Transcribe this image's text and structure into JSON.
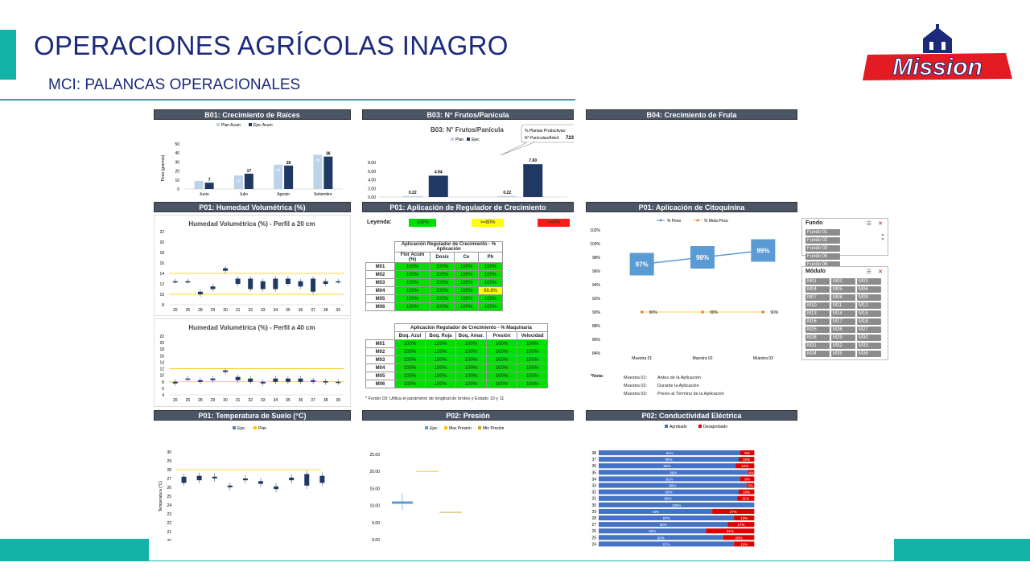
{
  "header": {
    "title": "OPERACIONES AGRÍCOLAS INAGRO",
    "subtitle": "MCI: PALANCAS OPERACIONALES",
    "logo_text": "Mission"
  },
  "panels": {
    "b01": "B01: Crecimiento de Raíces",
    "b03": "B03: N° Frutos/Panícula",
    "b04": "B04: Crecimiento de Fruta",
    "p01_humedad": "P01: Humedad Volumétrica (%)",
    "p01_regulador": "P01: Aplicación de Regulador de Crecimiento",
    "p01_citoquinina": "P01: Aplicación de Citoquinina",
    "p01_temp": "P01: Temperatura de Suelo (°C)",
    "p02_presion": "P02: Presión",
    "p02_conductividad": "P02: Conductividad Eléctrica"
  },
  "b03_callout": {
    "label1": "% Plantas Productivas:",
    "value1": "94",
    "label2": "N° Panículas/Árbol:",
    "value2": "723"
  },
  "regulador": {
    "leyenda_label": "Leyenda:",
    "leyenda": [
      "100%",
      ">=80%",
      ">=0%"
    ],
    "table1_title": "Aplicación Regulador de Crecimiento - % Aplicación",
    "table1_headers": [
      "Flor Acum (%)",
      "Dosis",
      "Ce",
      "Ph"
    ],
    "table2_title": "Aplicación Regulador de Crecimiento - % Maquinaria",
    "table2_headers": [
      "Boq. Azul",
      "Boq. Roja",
      "Boq. Amar.",
      "Presión",
      "Velocidad"
    ],
    "rows": [
      "M01",
      "M02",
      "M03",
      "M04",
      "M05",
      "M06"
    ],
    "t1_cells": [
      [
        "100%",
        "100%",
        "100%",
        "100%"
      ],
      [
        "100%",
        "100%",
        "100%",
        "100%"
      ],
      [
        "100%",
        "100%",
        "100%",
        "100%"
      ],
      [
        "100%",
        "100%",
        "100%",
        "99.8%"
      ],
      [
        "100%",
        "100%",
        "100%",
        "100%"
      ],
      [
        "100%",
        "100%",
        "100%",
        "100%"
      ]
    ],
    "t2_cells": [
      [
        "100%",
        "100%",
        "100%",
        "100%",
        "100%"
      ],
      [
        "100%",
        "100%",
        "100%",
        "100%",
        "100%"
      ],
      [
        "100%",
        "100%",
        "100%",
        "100%",
        "100%"
      ],
      [
        "100%",
        "100%",
        "100%",
        "100%",
        "100%"
      ],
      [
        "100%",
        "100%",
        "100%",
        "100%",
        "100%"
      ],
      [
        "100%",
        "100%",
        "100%",
        "100%",
        "100%"
      ]
    ],
    "footnote": "* Fundo 03: Utiliza el parámetro de longitud de brotes y Estado 10 y 11"
  },
  "citoquinina_notes": {
    "label": "*Nota:",
    "rows": [
      [
        "Muestra 01:",
        "Antes de la Aplicación"
      ],
      [
        "Muestra 02:",
        "Durante la Aplicación"
      ],
      [
        "Muestra 03:",
        "Previo al Término de la Aplicación"
      ]
    ]
  },
  "slicer_fundo": {
    "title": "Fundo",
    "items": [
      "Fundo 01",
      "Fundo 02",
      "Fundo 03",
      "Fundo 05",
      "Fundo 06",
      "ENSAYO"
    ]
  },
  "slicer_modulo": {
    "title": "Módulo",
    "items": [
      "M01",
      "M02",
      "M03",
      "M04",
      "M05",
      "M06",
      "M07",
      "M08",
      "M09",
      "M10",
      "M11",
      "M12",
      "M13",
      "M14",
      "M15",
      "M16",
      "M17",
      "M18",
      "M25",
      "M26",
      "M27",
      "M28",
      "M29",
      "M30",
      "M31",
      "M32",
      "M33",
      "M34",
      "M35",
      "M36"
    ]
  },
  "chart_data": [
    {
      "type": "bar",
      "id": "b01",
      "series": [
        {
          "name": "Plan Acum",
          "values": [
            9,
            15,
            27,
            38
          ]
        },
        {
          "name": "Ejec Acum",
          "values": [
            7,
            17,
            26,
            36
          ]
        }
      ],
      "categories": [
        "Junio",
        "Julio",
        "Agosto",
        "Setiembre"
      ],
      "group_label": "2024",
      "ylabel": "Peso (gramos)",
      "ylim": [
        0,
        50
      ],
      "yticks": [
        0,
        10,
        20,
        30,
        40,
        50
      ],
      "labels": [
        "7",
        "17",
        "26",
        "36"
      ],
      "plan_labels": [
        "",
        "18",
        "28",
        "38"
      ]
    },
    {
      "type": "bar",
      "id": "b03",
      "title": "B03: N° Frutos/Panícula",
      "series": [
        {
          "name": "Plan",
          "values": [
            0.22,
            0.22
          ]
        },
        {
          "name": "Ejec",
          "values": [
            4.94,
            7.6
          ]
        }
      ],
      "categories": [
        "37",
        "38"
      ],
      "ylim": [
        0,
        8
      ],
      "yticks": [
        "0.00",
        "2.00",
        "4.00",
        "6.00",
        "8.00"
      ],
      "labels_plan": [
        "0.22",
        "0.22"
      ],
      "labels_ejec": [
        "4.94",
        "7.60"
      ]
    },
    {
      "type": "box",
      "id": "hum20",
      "title": "Humedad Volumétrica (%) - Perfil a 20 cm",
      "categories": [
        "20",
        "25",
        "28",
        "29",
        "30",
        "31",
        "32",
        "33",
        "34",
        "35",
        "36",
        "37",
        "38",
        "39"
      ],
      "yticks": [
        8,
        10,
        12,
        14,
        16,
        18,
        20,
        22
      ],
      "ylim": [
        8,
        22
      ],
      "ref_lines": [
        14,
        10
      ],
      "boxes": [
        [
          12.5,
          12.5
        ],
        [
          12.5,
          12.5
        ],
        [
          10,
          10.5
        ],
        [
          11,
          11.5
        ],
        [
          14.5,
          15
        ],
        [
          12,
          13
        ],
        [
          11,
          13
        ],
        [
          11,
          12.5
        ],
        [
          11,
          13
        ],
        [
          12,
          13
        ],
        [
          11.5,
          12.5
        ],
        [
          10.5,
          13
        ],
        [
          12,
          12.5
        ],
        [
          12.5,
          12.5
        ]
      ]
    },
    {
      "type": "box",
      "id": "hum40",
      "title": "Humedad Volumétrica (%) - Perfil a 40 cm",
      "categories": [
        "20",
        "25",
        "28",
        "29",
        "30",
        "31",
        "32",
        "33",
        "34",
        "35",
        "36",
        "37",
        "38",
        "39"
      ],
      "yticks": [
        4,
        6,
        8,
        10,
        12,
        14,
        16,
        18,
        20,
        22
      ],
      "ylim": [
        4,
        22
      ],
      "ref_lines": [
        12,
        8
      ],
      "boxes": [
        [
          7.5,
          8
        ],
        [
          9,
          9
        ],
        [
          8,
          8.5
        ],
        [
          8.5,
          9
        ],
        [
          11,
          11.5
        ],
        [
          8.5,
          9.5
        ],
        [
          8,
          9
        ],
        [
          7.5,
          8
        ],
        [
          8,
          9
        ],
        [
          8,
          9
        ],
        [
          8,
          9
        ],
        [
          8,
          8.5
        ],
        [
          7.8,
          8.2
        ],
        [
          7.8,
          8
        ]
      ]
    },
    {
      "type": "line",
      "id": "citoquinina",
      "series": [
        {
          "name": "% Peso",
          "values": [
            97,
            98,
            99
          ]
        },
        {
          "name": "% Meta Peso",
          "values": [
            90,
            90,
            90
          ]
        }
      ],
      "categories": [
        "Muestra 01",
        "Muestra 02",
        "Muestra 03"
      ],
      "ylim": [
        84,
        102
      ],
      "yticks": [
        "84%",
        "86%",
        "88%",
        "90%",
        "92%",
        "94%",
        "96%",
        "98%",
        "100%",
        "102%"
      ],
      "labels": [
        "97%",
        "98%",
        "99%"
      ],
      "meta_labels": [
        "90%",
        "90%",
        "90%"
      ]
    },
    {
      "type": "box",
      "id": "temp",
      "series_names": [
        "Ejec",
        "Plan"
      ],
      "categories": [
        "30",
        "31",
        "32",
        "33",
        "34",
        "35",
        "36",
        "37",
        "38",
        "39",
        "#N/A"
      ],
      "ylabel": "Temperatura (°C)",
      "ylim": [
        20,
        30
      ],
      "yticks": [
        20,
        21,
        22,
        23,
        24,
        25,
        26,
        27,
        28,
        29,
        30
      ],
      "plan": 28,
      "boxes": [
        [
          26.5,
          27.2
        ],
        [
          26.8,
          27.3
        ],
        [
          27,
          27.2
        ],
        [
          26,
          26.2
        ],
        [
          26.8,
          27
        ],
        [
          26.4,
          26.7
        ],
        [
          25.8,
          26.1
        ],
        [
          26.8,
          27.1
        ],
        [
          26.2,
          27.5
        ],
        [
          26.5,
          27.3
        ]
      ]
    },
    {
      "type": "scatter",
      "id": "presion",
      "series_names": [
        "Ejec",
        "Max Presión",
        "Min Presión"
      ],
      "categories": [
        "36"
      ],
      "ylim": [
        0,
        25
      ],
      "yticks": [
        "0.00",
        "5.00",
        "10.00",
        "15.00",
        "20.00",
        "25.00"
      ],
      "box": [
        10.5,
        11.2
      ],
      "max": 20,
      "min": 8
    },
    {
      "type": "bar",
      "id": "conductividad",
      "orientation": "horizontal",
      "stacked": true,
      "series_names": [
        "Aprobado",
        "Desaprobado"
      ],
      "categories": [
        "38",
        "37",
        "36",
        "35",
        "34",
        "33",
        "32",
        "31",
        "30",
        "29",
        "28",
        "27",
        "26",
        "25",
        "24"
      ],
      "aprobado": [
        91,
        90,
        88,
        96,
        91,
        95,
        90,
        89,
        100,
        73,
        87,
        83,
        69,
        80,
        87
      ],
      "desaprobado": [
        9,
        10,
        12,
        4,
        9,
        5,
        10,
        11,
        0,
        27,
        13,
        17,
        31,
        20,
        13
      ],
      "xticks": [
        "0%",
        "20%",
        "40%",
        "60%",
        "80%",
        "100%",
        "120%"
      ]
    }
  ]
}
